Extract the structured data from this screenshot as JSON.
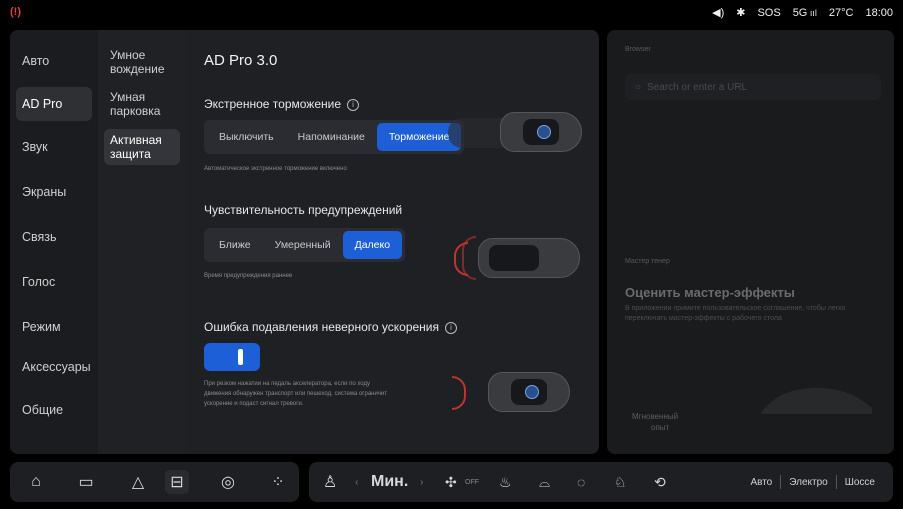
{
  "status": {
    "warning_icon": "brake-warning-icon",
    "sos": "SOS",
    "signal": "5G",
    "temperature": "27°C",
    "time": "18:00"
  },
  "nav": {
    "items": [
      {
        "label": "Авто"
      },
      {
        "label": "AD Pro"
      },
      {
        "label": "Звук"
      },
      {
        "label": "Экраны"
      },
      {
        "label": "Связь"
      },
      {
        "label": "Голос"
      },
      {
        "label": "Режим"
      },
      {
        "label": "Аксессуары"
      },
      {
        "label": "Общие"
      }
    ],
    "active_index": 1
  },
  "subnav": {
    "items": [
      {
        "label": "Умное вождение"
      },
      {
        "label": "Умная парковка"
      },
      {
        "label": "Активная защита"
      }
    ],
    "active_index": 2
  },
  "content": {
    "title": "AD Pro 3.0",
    "braking": {
      "label": "Экстренное торможение",
      "options": [
        "Выключить",
        "Напоминание",
        "Торможение"
      ],
      "selected": "Торможение",
      "hint": "Автоматическое экстренное торможение включено"
    },
    "sensitivity": {
      "label": "Чувствительность предупреждений",
      "options": [
        "Ближе",
        "Умеренный",
        "Далеко"
      ],
      "selected": "Далеко",
      "hint": "Время предупреждения раннее"
    },
    "acceleration": {
      "label": "Ошибка подавления неверного ускорения",
      "enabled": true,
      "desc": "При резком нажатии на педаль акселератора, если по ходу движения обнаружен транспорт или пешеход, система ограничит ускорение и подаст сигнал тревоги."
    }
  },
  "right_panel": {
    "browser_label": "Browser",
    "search_placeholder": "Search or enter a URL",
    "master_label": "Мастер тенер",
    "master_title": "Оценить мастер-эффекты",
    "master_desc": "В приложении примите пользовательское соглашение, чтобы легко переключать мастер-эффекты с рабочего стола",
    "instant_line1": "Мгновенный",
    "instant_line2": "опыт"
  },
  "bottom": {
    "fan_label": "Мин.",
    "fan_off": "OFF",
    "modes": [
      "Авто",
      "Электро",
      "Шоссе"
    ]
  },
  "colors": {
    "accent": "#1d5fd6",
    "warning": "#e1412e"
  }
}
